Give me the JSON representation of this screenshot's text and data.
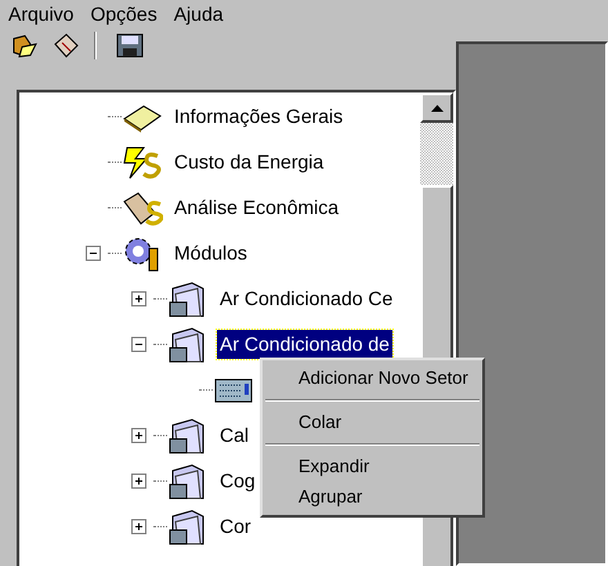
{
  "menu_bar": [
    "Arquivo",
    "Opções",
    "Ajuda"
  ],
  "tree": [
    {
      "label": "Informações Gerais",
      "kind": "info"
    },
    {
      "label": "Custo da Energia",
      "kind": "energy"
    },
    {
      "label": "Análise Econômica",
      "kind": "finance"
    },
    {
      "label": "Módulos",
      "kind": "modules",
      "expanded": true,
      "children": [
        {
          "label": "Ar Condicionado Ce",
          "kind": "folder",
          "expanded": false,
          "selected": false
        },
        {
          "label": "Ar Condicionado de",
          "kind": "folder",
          "expanded": true,
          "selected": true,
          "children": [
            {
              "kind": "sector"
            }
          ]
        },
        {
          "label": "Cal",
          "kind": "folder",
          "expanded": false,
          "selected": false
        },
        {
          "label": "Cog",
          "kind": "folder",
          "expanded": false,
          "selected": false
        },
        {
          "label": "Cor",
          "kind": "folder",
          "expanded": false,
          "selected": false
        }
      ]
    }
  ],
  "context_menu": [
    {
      "label": "Adicionar Novo Setor",
      "kind": "item"
    },
    {
      "kind": "separator"
    },
    {
      "label": "Colar",
      "kind": "item"
    },
    {
      "kind": "separator"
    },
    {
      "label": "Expandir",
      "kind": "item"
    },
    {
      "label": "Agrupar",
      "kind": "item"
    }
  ]
}
